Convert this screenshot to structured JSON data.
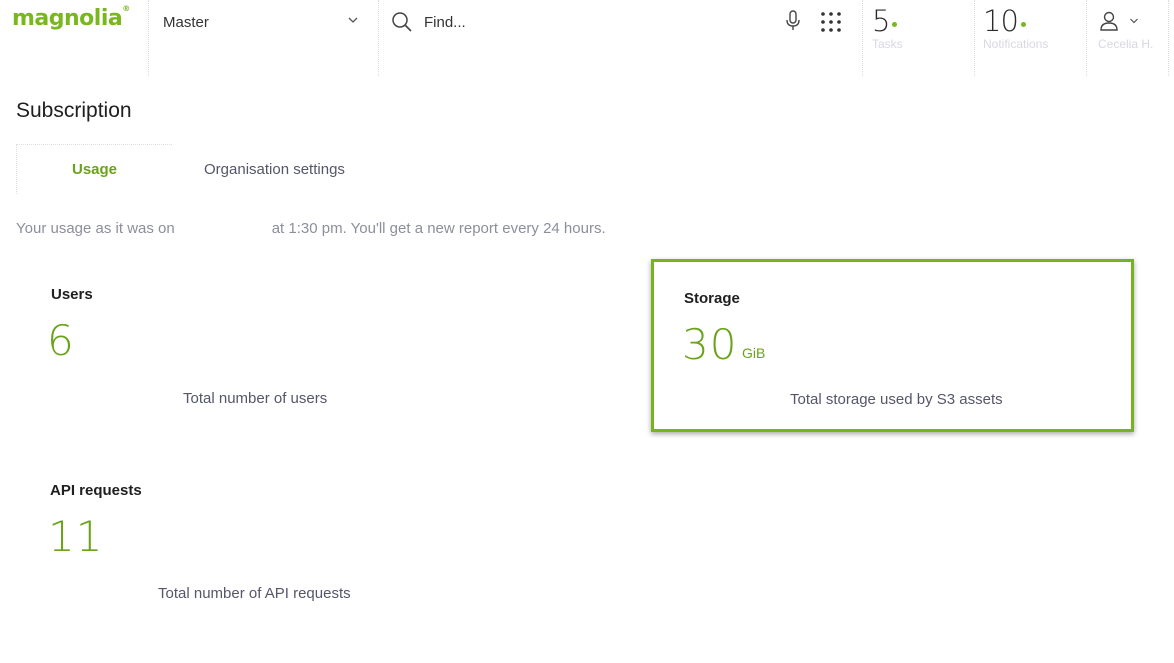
{
  "brand": {
    "logo_text": "magnolia",
    "trademark": "®",
    "accent": "#78b81e"
  },
  "header": {
    "workspace": {
      "selected": "Master"
    },
    "search": {
      "placeholder": "Find..."
    },
    "tasks": {
      "count": "5",
      "label": "Tasks"
    },
    "notifications": {
      "count": "10",
      "label": "Notifications"
    },
    "user": {
      "name": "Cecelia H."
    }
  },
  "page": {
    "title": "Subscription",
    "tabs": [
      {
        "label": "Usage",
        "active": true
      },
      {
        "label": "Organisation settings",
        "active": false
      }
    ],
    "usage_note": {
      "prefix": "Your usage as it was on",
      "suffix": "at 1:30 pm. You'll get a new report every 24 hours."
    }
  },
  "cards": {
    "users": {
      "title": "Users",
      "value": "6",
      "description": "Total number of users"
    },
    "storage": {
      "title": "Storage",
      "value": "30",
      "unit": "GiB",
      "description": "Total storage used by S3 assets",
      "highlight_color": "#77b21f"
    },
    "api_requests": {
      "title": "API requests",
      "value": "11",
      "description": "Total number of API requests"
    }
  }
}
